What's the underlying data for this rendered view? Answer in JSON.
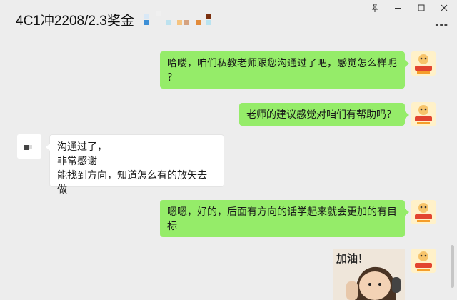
{
  "header": {
    "title": "4C1冲2208/2.3奖金",
    "pin_icon": "pin-icon",
    "minimize_icon": "minimize-icon",
    "maximize_icon": "maximize-icon",
    "close_icon": "close-icon",
    "more_icon": "more-icon"
  },
  "messages": [
    {
      "from": "self",
      "lines": [
        "哈喽，咱们私教老师跟您沟通过了吧，感觉怎么样呢",
        "？"
      ]
    },
    {
      "from": "self",
      "lines": [
        "老师的建议感觉对咱们有帮助吗？"
      ]
    },
    {
      "from": "other",
      "lines": [
        "沟通过了，",
        "非常感谢",
        "能找到方向，知道怎么有的放矢去做"
      ]
    },
    {
      "from": "self",
      "lines": [
        "嗯嗯，好的，后面有方向的话学起来就会更加的有目",
        "标"
      ]
    },
    {
      "from": "self",
      "type": "sticker",
      "sticker_text": "加油！"
    }
  ],
  "colors": {
    "outgoing_bubble": "#95ec69",
    "incoming_bubble": "#ffffff",
    "background": "#ededed"
  }
}
